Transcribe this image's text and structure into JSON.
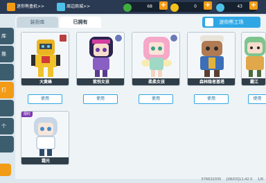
{
  "topbar": {
    "link1": "迷你熊盒机>>",
    "link2": "周边商城>>",
    "res1": "68",
    "res2": "0",
    "res3": "43",
    "colors": {
      "bg": "#2a3a52",
      "gem": "#3fae3f",
      "coin": "#f2c21a",
      "token": "#4ec1e8"
    }
  },
  "sidebar": {
    "tabs": [
      "库",
      "推",
      "",
      "",
      "打",
      "",
      "个",
      "",
      ""
    ]
  },
  "tabs": {
    "dressing": "装扮库",
    "owned": "已拥有"
  },
  "workshop": "迷你熊工场",
  "cards": [
    {
      "name": "大黄蜂",
      "use": "使用",
      "badge": "transformers"
    },
    {
      "name": "紫悦女孩",
      "use": "使用",
      "badge": "pony"
    },
    {
      "name": "柔柔女孩",
      "use": "使用",
      "badge": "pony"
    },
    {
      "name": "森林隐者基塔",
      "use": "使用",
      "badge": "none"
    },
    {
      "name": "霸江",
      "use": "使用",
      "badge": "none"
    },
    {
      "name": "霜光",
      "use": "使用",
      "badge": "limited",
      "tag": "限时"
    }
  ],
  "footer": {
    "id": "576632035",
    "time": "[08/03]11:42 0",
    "page": "1/8"
  }
}
